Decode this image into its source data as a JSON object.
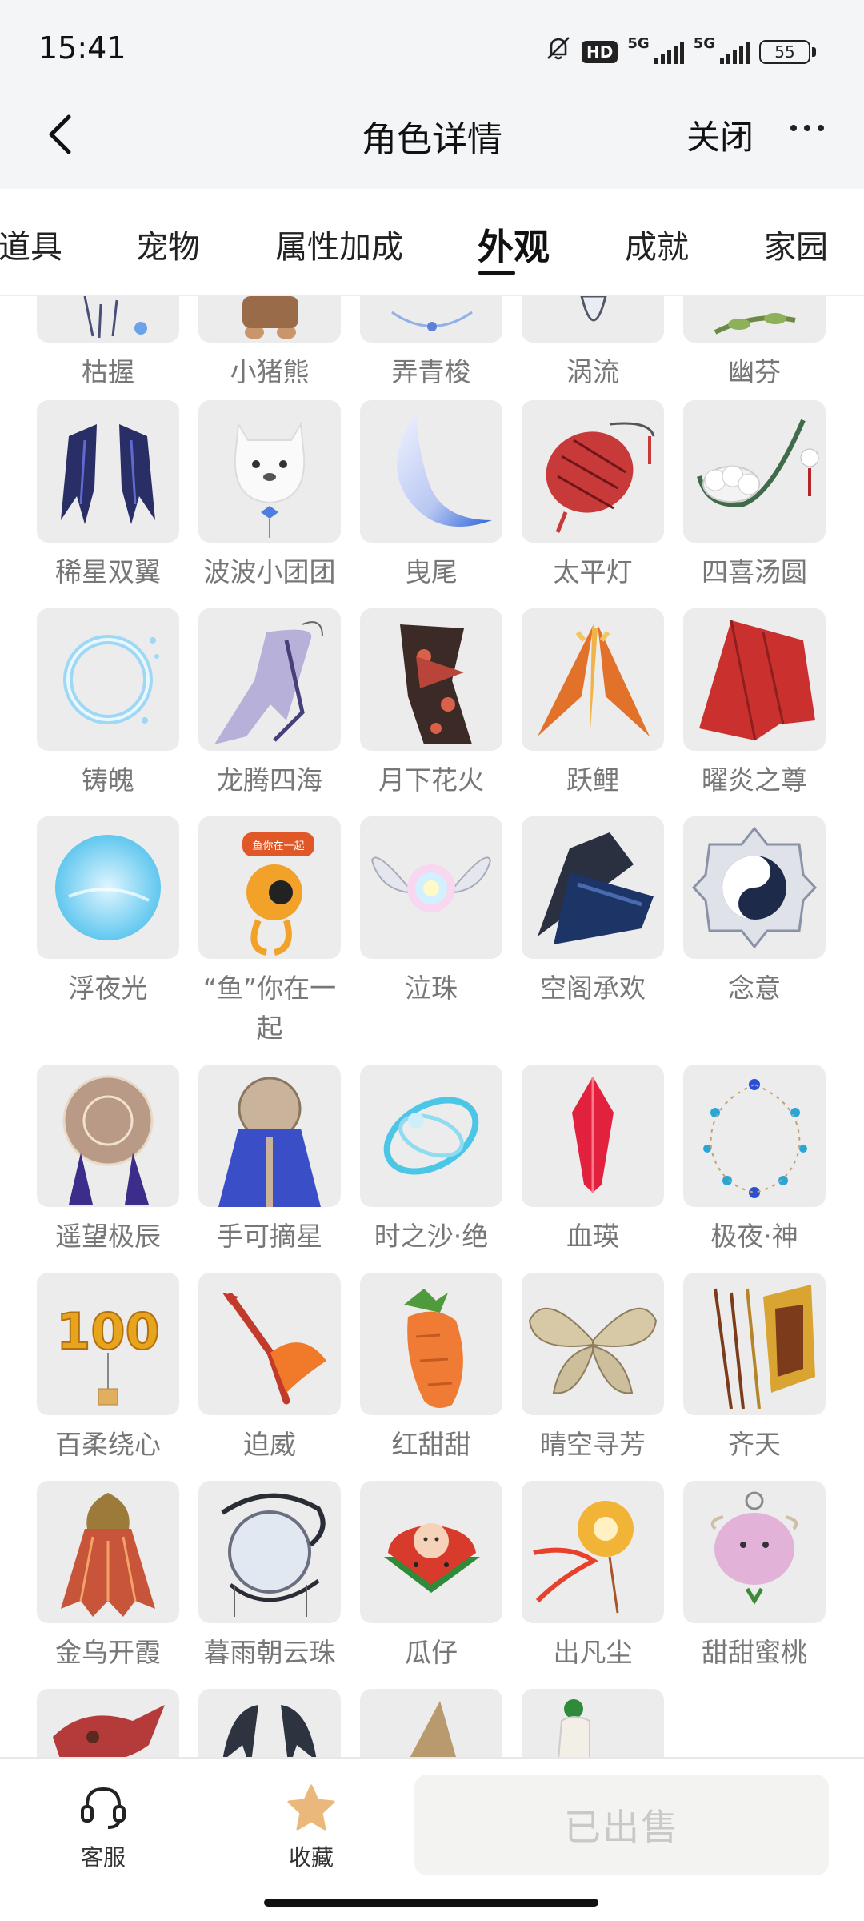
{
  "status_bar": {
    "time": "15:41",
    "hd": "HD",
    "net1": "5G",
    "net2": "5G",
    "battery": "55"
  },
  "nav": {
    "title": "角色详情",
    "close": "关闭"
  },
  "tabs": [
    {
      "label": "道具",
      "active": false
    },
    {
      "label": "宠物",
      "active": false
    },
    {
      "label": "属性加成",
      "active": false
    },
    {
      "label": "外观",
      "active": true
    },
    {
      "label": "成就",
      "active": false
    },
    {
      "label": "家园",
      "active": false
    }
  ],
  "items_top_partial": [
    "枯握",
    "小猪熊",
    "弄青梭",
    "涡流",
    "幽芬"
  ],
  "items": [
    "稀星双翼",
    "波波小团团",
    "曳尾",
    "太平灯",
    "四喜汤圆",
    "铸魄",
    "龙腾四海",
    "月下花火",
    "跃鲤",
    "曜炎之尊",
    "浮夜光",
    "“鱼”你在一起",
    "泣珠",
    "空阁承欢",
    "念意",
    "遥望极辰",
    "手可摘星",
    "时之沙·绝",
    "血瑛",
    "极夜·神",
    "百柔绕心",
    "迫威",
    "红甜甜",
    "晴空寻芳",
    "齐天",
    "金乌开霞",
    "暮雨朝云珠",
    "瓜仔",
    "出凡尘",
    "甜甜蜜桃"
  ],
  "thumb_art": {
    "100_balloon_text": "100",
    "pendant_text": "鱼你在一起"
  },
  "bottom": {
    "service": "客服",
    "favorite": "收藏",
    "sold": "已出售"
  },
  "colors": {
    "star": "#e9b87a",
    "sold_text": "#c9c9c9",
    "label": "#777777"
  }
}
